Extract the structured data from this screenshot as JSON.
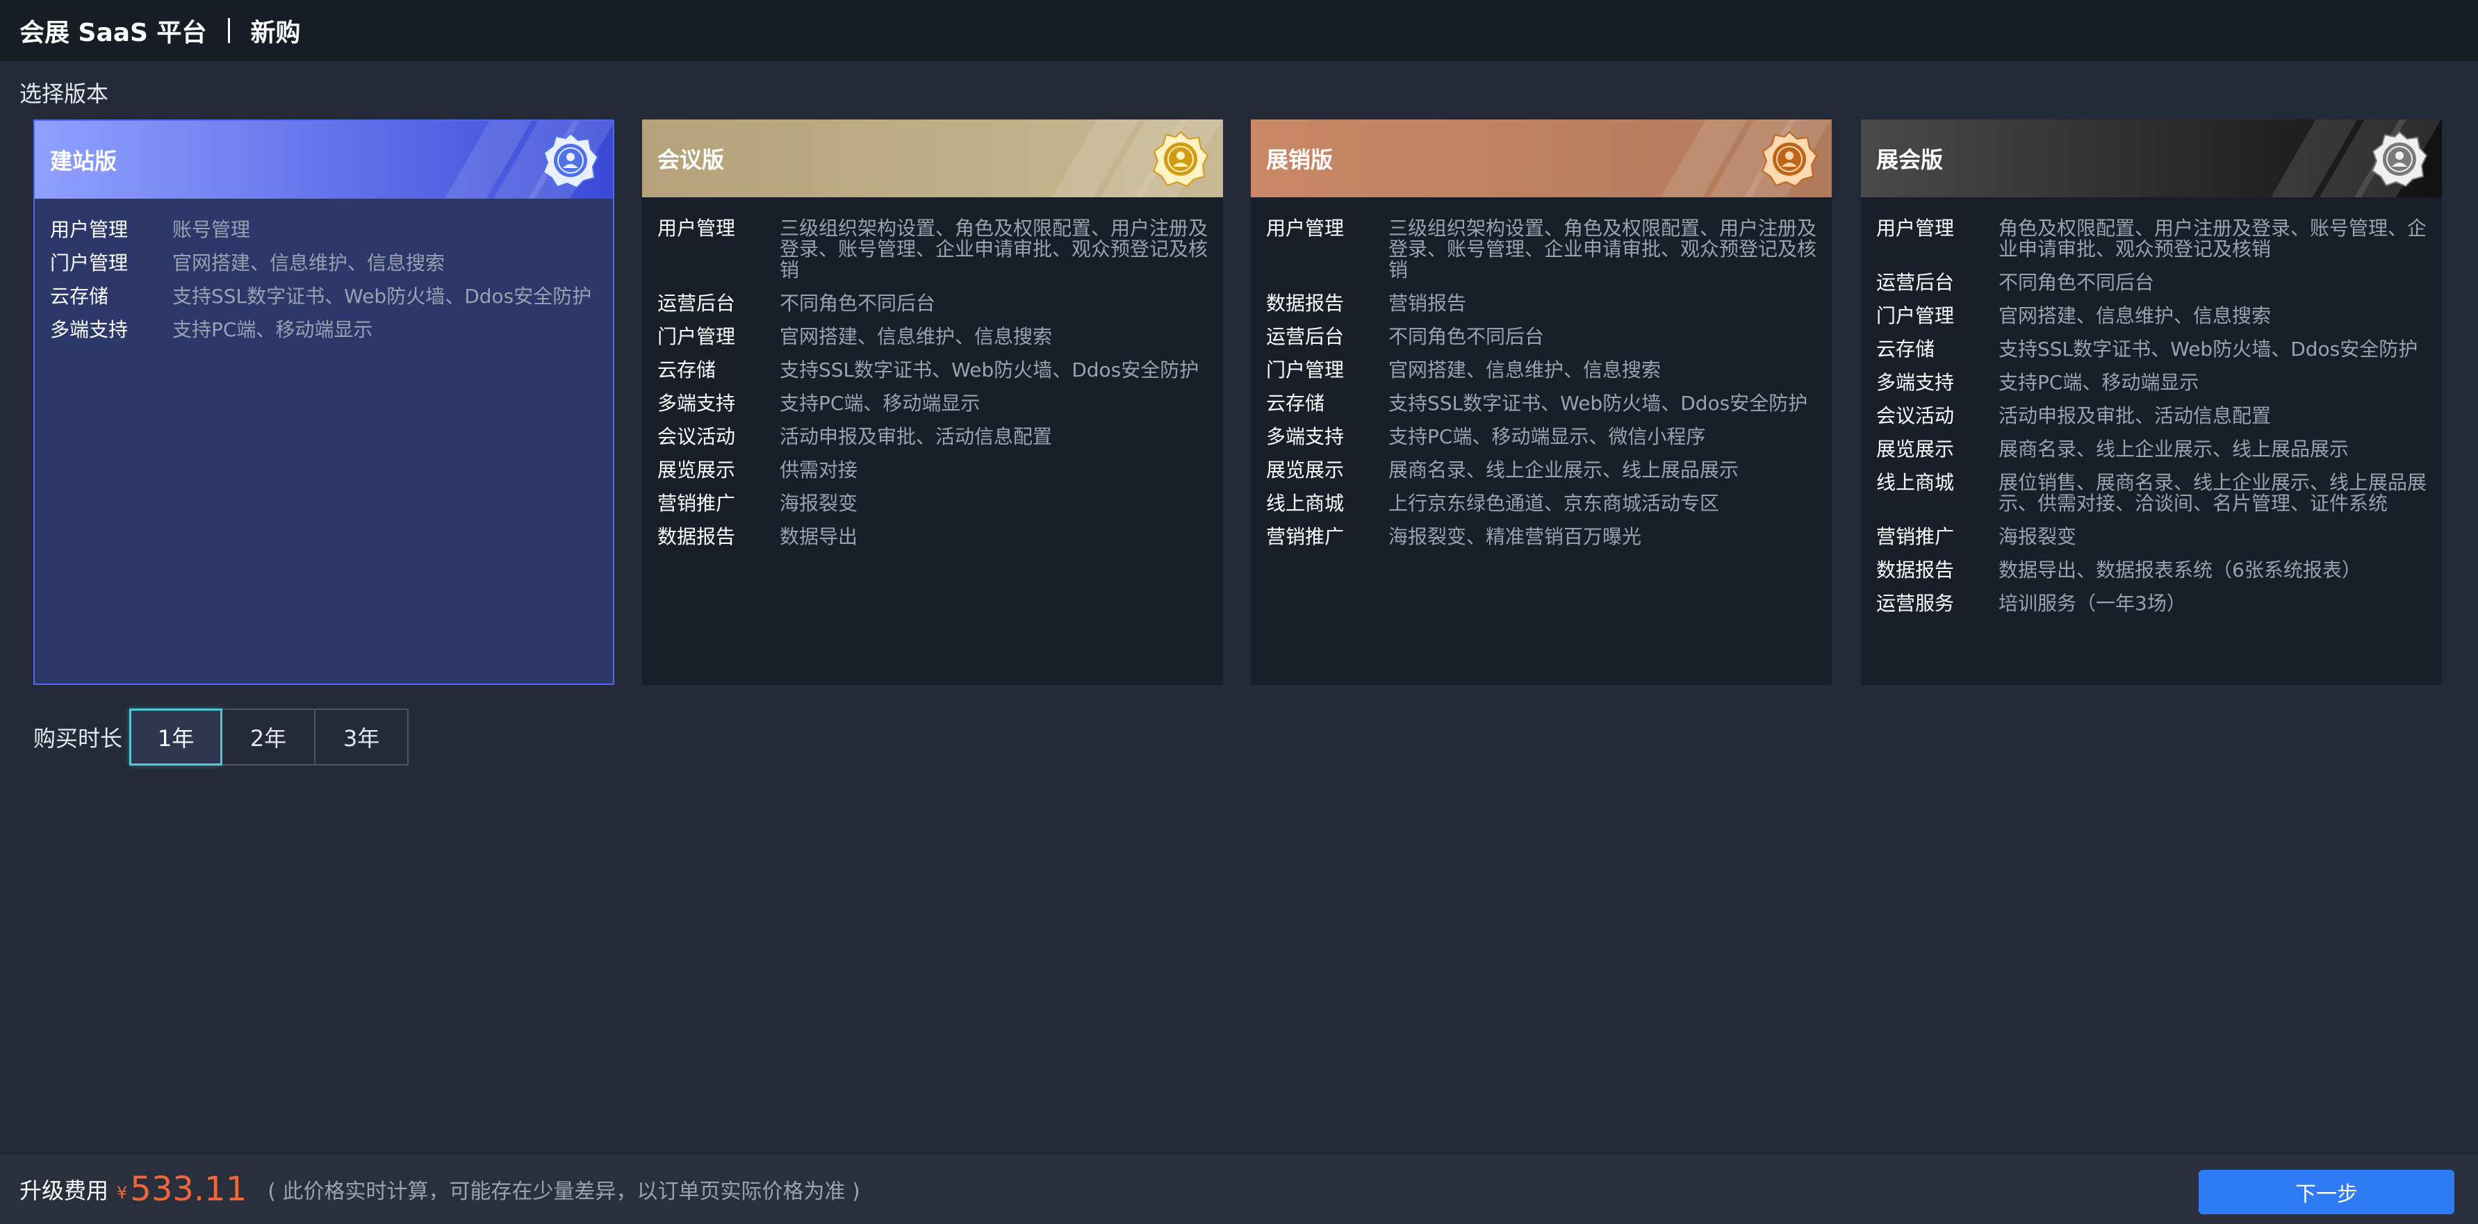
{
  "header": {
    "platform": "会展 SaaS 平台",
    "page": "新购"
  },
  "section_title": "选择版本",
  "editions": [
    {
      "name": "建站版",
      "selected": true,
      "header_gradient": [
        "#8fa0ff",
        "#3a4ad8"
      ],
      "features": [
        {
          "name": "用户管理",
          "desc": "账号管理"
        },
        {
          "name": "门户管理",
          "desc": "官网搭建、信息维护、信息搜索"
        },
        {
          "name": "云存储",
          "desc": "支持SSL数字证书、Web防火墙、Ddos安全防护"
        },
        {
          "name": "多端支持",
          "desc": "支持PC端、移动端显示"
        }
      ]
    },
    {
      "name": "会议版",
      "selected": false,
      "header_gradient": [
        "#b5a27a",
        "#c9b894"
      ],
      "features": [
        {
          "name": "用户管理",
          "desc": "三级组织架构设置、角色及权限配置、用户注册及登录、账号管理、企业申请审批、观众预登记及核销"
        },
        {
          "name": "运营后台",
          "desc": "不同角色不同后台"
        },
        {
          "name": "门户管理",
          "desc": "官网搭建、信息维护、信息搜索"
        },
        {
          "name": "云存储",
          "desc": "支持SSL数字证书、Web防火墙、Ddos安全防护"
        },
        {
          "name": "多端支持",
          "desc": "支持PC端、移动端显示"
        },
        {
          "name": "会议活动",
          "desc": "活动申报及审批、活动信息配置"
        },
        {
          "name": "展览展示",
          "desc": "供需对接"
        },
        {
          "name": "营销推广",
          "desc": "海报裂变"
        },
        {
          "name": "数据报告",
          "desc": "数据导出"
        }
      ]
    },
    {
      "name": "展销版",
      "selected": false,
      "header_gradient": [
        "#c98866",
        "#b07a5c"
      ],
      "features": [
        {
          "name": "用户管理",
          "desc": "三级组织架构设置、角色及权限配置、用户注册及登录、账号管理、企业申请审批、观众预登记及核销"
        },
        {
          "name": "数据报告",
          "desc": "营销报告"
        },
        {
          "name": "运营后台",
          "desc": "不同角色不同后台"
        },
        {
          "name": "门户管理",
          "desc": "官网搭建、信息维护、信息搜索"
        },
        {
          "name": "云存储",
          "desc": "支持SSL数字证书、Web防火墙、Ddos安全防护"
        },
        {
          "name": "多端支持",
          "desc": "支持PC端、移动端显示、微信小程序"
        },
        {
          "name": "展览展示",
          "desc": "展商名录、线上企业展示、线上展品展示"
        },
        {
          "name": "线上商城",
          "desc": "上行京东绿色通道、京东商城活动专区"
        },
        {
          "name": "营销推广",
          "desc": "海报裂变、精准营销百万曝光"
        }
      ]
    },
    {
      "name": "展会版",
      "selected": false,
      "header_gradient": [
        "#4a4a4a",
        "#111111"
      ],
      "features": [
        {
          "name": "用户管理",
          "desc": "角色及权限配置、用户注册及登录、账号管理、企业申请审批、观众预登记及核销"
        },
        {
          "name": "运营后台",
          "desc": "不同角色不同后台"
        },
        {
          "name": "门户管理",
          "desc": "官网搭建、信息维护、信息搜索"
        },
        {
          "name": "云存储",
          "desc": "支持SSL数字证书、Web防火墙、Ddos安全防护"
        },
        {
          "name": "多端支持",
          "desc": "支持PC端、移动端显示"
        },
        {
          "name": "会议活动",
          "desc": "活动申报及审批、活动信息配置"
        },
        {
          "name": "展览展示",
          "desc": "展商名录、线上企业展示、线上展品展示"
        },
        {
          "name": "线上商城",
          "desc": "展位销售、展商名录、线上企业展示、线上展品展示、供需对接、洽谈间、名片管理、证件系统"
        },
        {
          "name": "营销推广",
          "desc": "海报裂变"
        },
        {
          "name": "数据报告",
          "desc": "数据导出、数据报表系统（6张系统报表）"
        },
        {
          "name": "运营服务",
          "desc": "培训服务（一年3场）"
        }
      ]
    }
  ],
  "duration": {
    "label": "购买时长",
    "options": [
      "1年",
      "2年",
      "3年"
    ],
    "selected": "1年"
  },
  "footer": {
    "fee_label": "升级费用",
    "currency": "¥",
    "price": "533.11",
    "note": "( 此价格实时计算，可能存在少量差异，以订单页实际价格为准 )",
    "next_label": "下一步"
  }
}
